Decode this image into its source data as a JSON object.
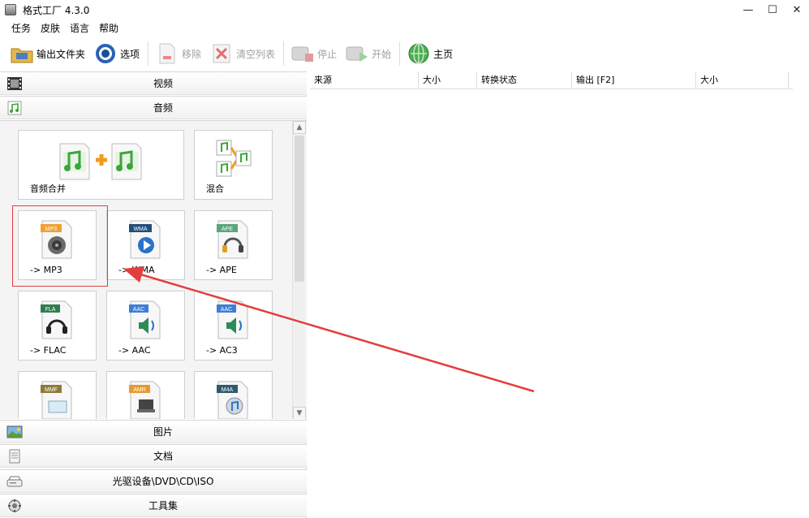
{
  "window": {
    "title": "格式工厂 4.3.0",
    "controls": {
      "minimize": "—",
      "maximize": "☐",
      "close": "✕"
    }
  },
  "menu": {
    "items": [
      "任务",
      "皮肤",
      "语言",
      "帮助"
    ]
  },
  "toolbar": {
    "output_folder": "输出文件夹",
    "options": "选项",
    "remove": "移除",
    "clear_list": "清空列表",
    "stop": "停止",
    "start": "开始",
    "home": "主页"
  },
  "sidebar": {
    "video": "视频",
    "audio": "音频",
    "picture": "图片",
    "document": "文档",
    "optical": "光驱设备\\DVD\\CD\\ISO",
    "toolbox": "工具集"
  },
  "audio_tiles": {
    "merge": "音频合并",
    "mix": "混合",
    "mp3": "-> MP3",
    "wma": "-> WMA",
    "ape": "-> APE",
    "flac": "-> FLAC",
    "aac": "-> AAC",
    "ac3": "-> AC3"
  },
  "badges": {
    "mp3": "MP3",
    "wma": "WMA",
    "ape": "APE",
    "fla": "FLA",
    "aac": "AAC",
    "aac2": "AAC",
    "mmf": "MMF",
    "amr": "AMR",
    "m4a": "M4A"
  },
  "task_table": {
    "columns": [
      "来源",
      "大小",
      "转换状态",
      "输出 [F2]",
      "大小"
    ]
  },
  "colors": {
    "annotation_red": "#e43d3d",
    "music_green": "#3aa63a",
    "plus_orange": "#f39a1e"
  }
}
